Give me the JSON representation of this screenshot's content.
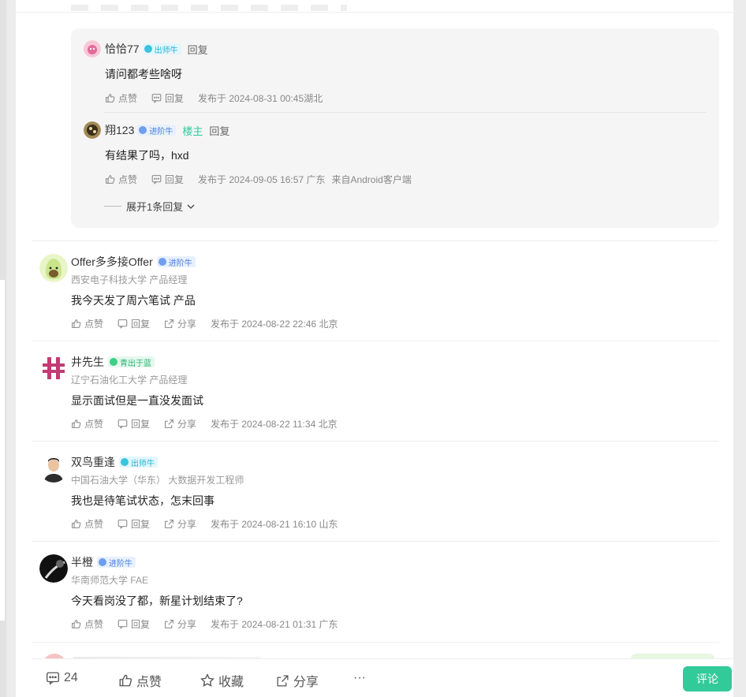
{
  "replies": [
    {
      "user": "恰恰77",
      "badge": "出师牛",
      "badge_color": "#1fb6d8",
      "is_owner": false,
      "reply_label": "回复",
      "text": "请问都考些啥呀",
      "like_label": "点赞",
      "reply_action": "回复",
      "posted": "发布于 2024-08-31 00:45湖北",
      "source": ""
    },
    {
      "user": "翔123",
      "badge": "进阶牛",
      "badge_color": "#4a7fe0",
      "is_owner": true,
      "owner_label": "楼主",
      "reply_label": "回复",
      "text": "有结果了吗，hxd",
      "like_label": "点赞",
      "reply_action": "回复",
      "posted": "发布于 2024-09-05 16:57 广东",
      "source": "来自Android客户端"
    }
  ],
  "expand_label": "展开1条回复",
  "comments": [
    {
      "user": "Offer多多接Offer",
      "badge": "进阶牛",
      "school": "西安电子科技大学 产品经理",
      "text": "我今天发了周六笔试 产品",
      "like": "点赞",
      "reply": "回复",
      "share": "分享",
      "posted": "发布于 2024-08-22 22:46 北京"
    },
    {
      "user": "井先生",
      "badge": "青出于蓝",
      "school": "辽宁石油化工大学 产品经理",
      "text": "显示面试但是一直没发面试",
      "like": "点赞",
      "reply": "回复",
      "share": "分享",
      "posted": "发布于 2024-08-22 11:34 北京"
    },
    {
      "user": "双鸟重逢",
      "badge": "出师牛",
      "school": "中国石油大学（华东） 大数据开发工程师",
      "text": "我也是待笔试状态，怎末回事",
      "like": "点赞",
      "reply": "回复",
      "share": "分享",
      "posted": "发布于 2024-08-21 16:10 山东"
    },
    {
      "user": "半橙",
      "badge": "进阶牛",
      "school": "华南师范大学 FAE",
      "text": "今天看岗没了都，新星计划结束了?",
      "like": "点赞",
      "reply": "回复",
      "share": "分享",
      "posted": "发布于 2024-08-21 01:31 广东"
    }
  ],
  "bottom": {
    "comment_count": "24",
    "like": "点赞",
    "favorite": "收藏",
    "share": "分享",
    "more": "···",
    "comment_button": "评论"
  },
  "accent_color": "#32ca99"
}
